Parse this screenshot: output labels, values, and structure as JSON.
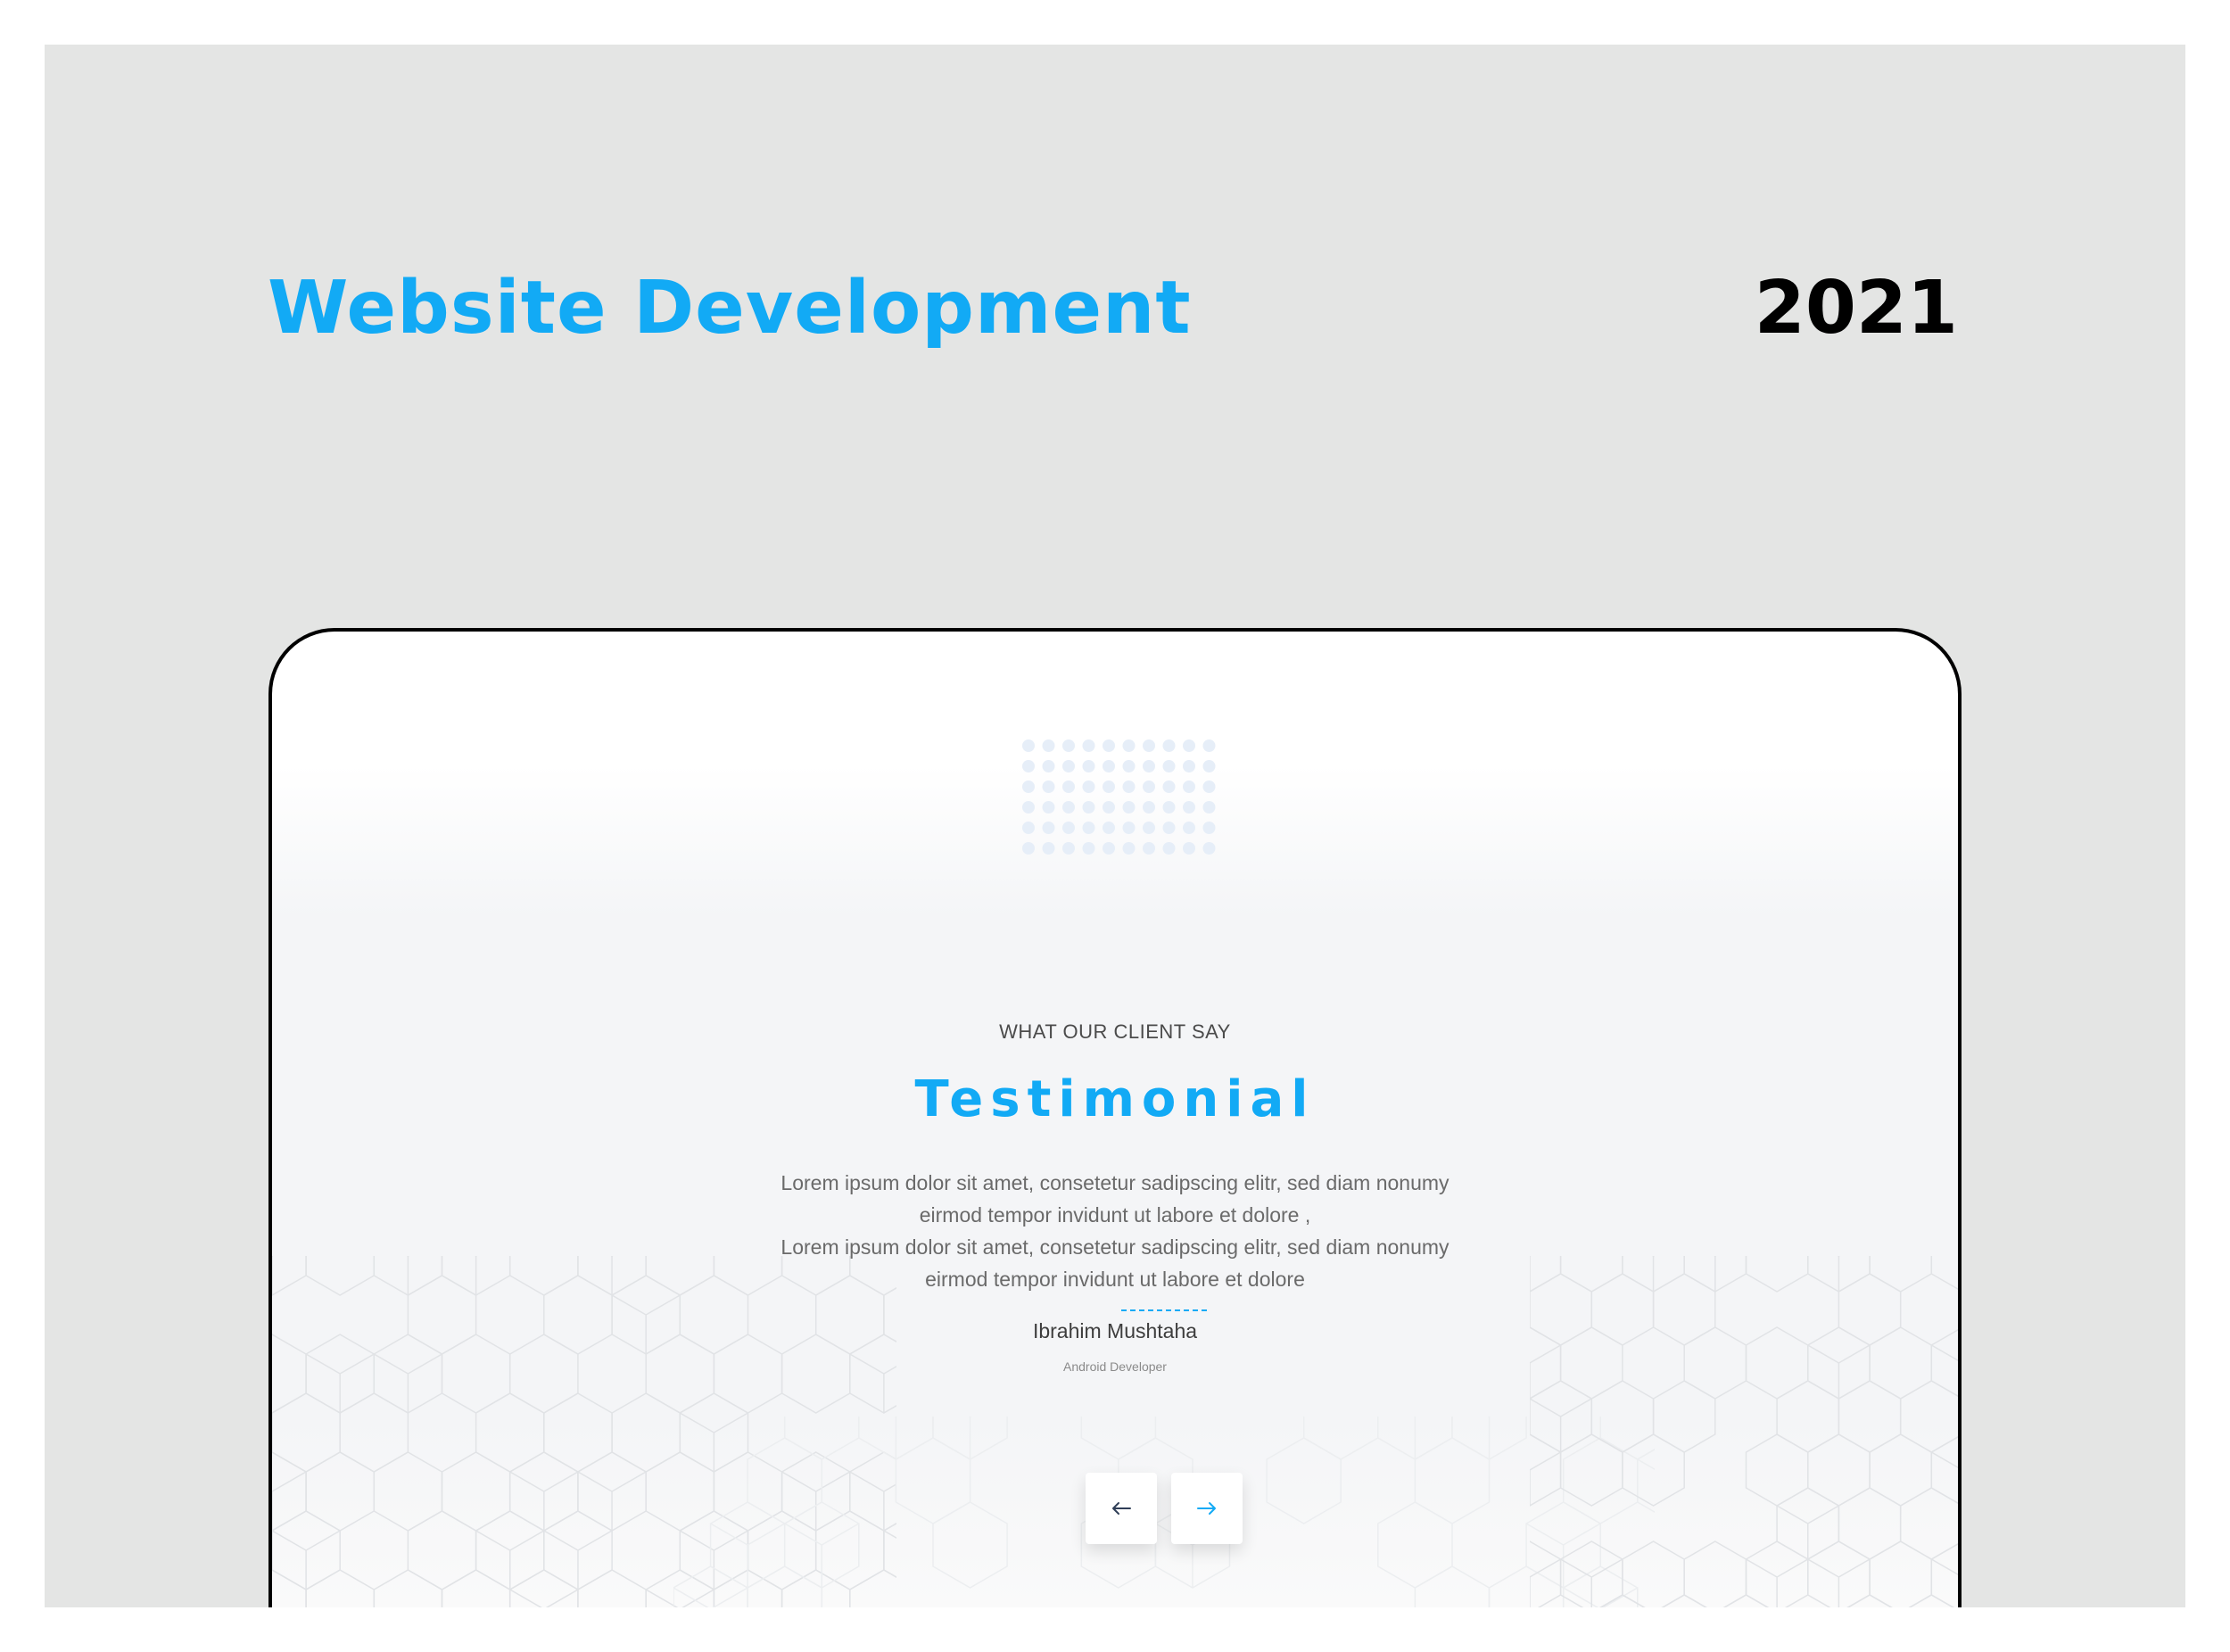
{
  "header": {
    "title": "Website Development",
    "year": "2021"
  },
  "colors": {
    "accent": "#12aaf5",
    "background": "#e4e5e4",
    "text_dark": "#000000"
  },
  "testimonial": {
    "eyebrow": "WHAT OUR CLIENT SAY",
    "title": "Testimonial",
    "quote_lines": [
      "Lorem ipsum dolor sit amet, consetetur sadipscing elitr, sed diam nonumy",
      "eirmod tempor invidunt ut labore et dolore ,",
      "Lorem ipsum dolor sit amet, consetetur sadipscing elitr, sed diam nonumy",
      "eirmod tempor invidunt ut labore et dolore"
    ],
    "author": "Ibrahim Mushtaha",
    "role": "Android Developer"
  },
  "controls": {
    "prev_icon": "arrow-left-icon",
    "next_icon": "arrow-right-icon"
  }
}
